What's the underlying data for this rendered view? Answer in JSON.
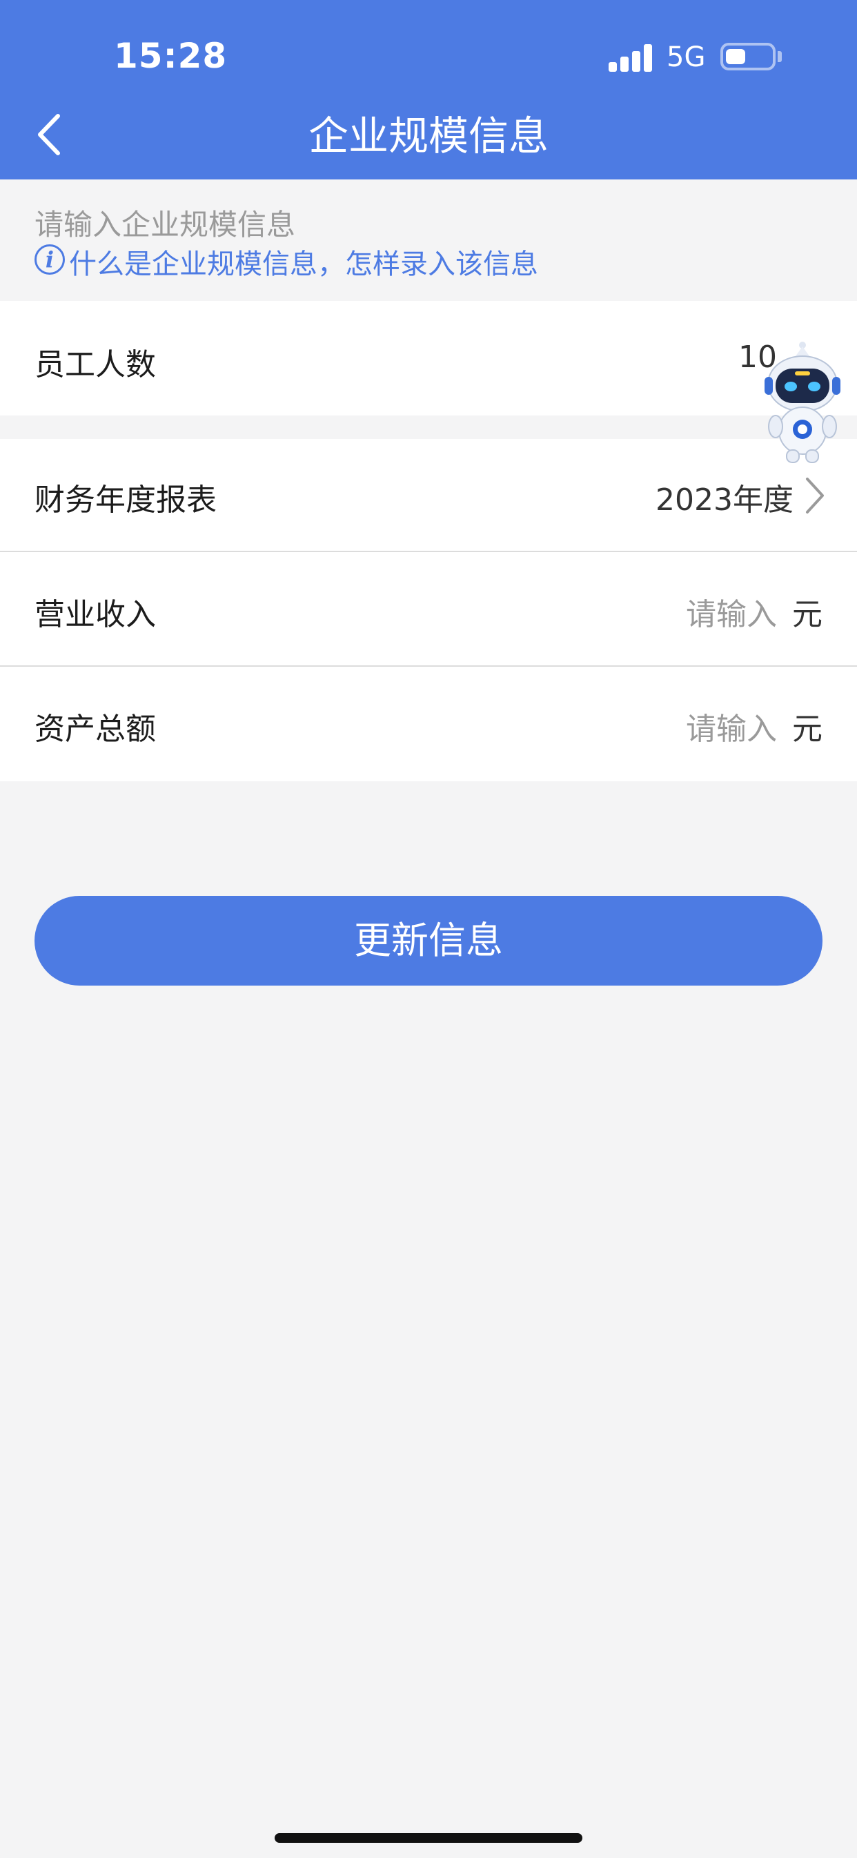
{
  "status_bar": {
    "time": "15:28",
    "network": "5G"
  },
  "nav": {
    "title": "企业规模信息",
    "back_icon": "chevron-left-icon"
  },
  "intro": {
    "hint": "请输入企业规模信息",
    "link": "什么是企业规模信息，怎样录入该信息",
    "info_icon_glyph": "i"
  },
  "form": {
    "employees": {
      "label": "员工人数",
      "value": "10"
    },
    "fiscal_report": {
      "label": "财务年度报表",
      "value": "2023年度"
    },
    "revenue": {
      "label": "营业收入",
      "placeholder": "请输入",
      "unit": "元"
    },
    "assets": {
      "label": "资产总额",
      "placeholder": "请输入",
      "unit": "元"
    }
  },
  "actions": {
    "update_label": "更新信息"
  },
  "colors": {
    "primary": "#4d7be3",
    "background": "#f4f4f5"
  }
}
